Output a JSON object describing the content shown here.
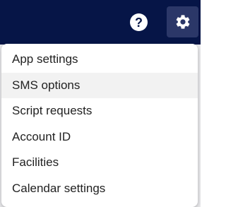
{
  "header": {
    "background": "#061547",
    "help_icon": "question-circle-icon",
    "help_glyph": "?",
    "settings_icon": "gear-icon"
  },
  "settings_menu": {
    "items": [
      {
        "label": "App settings"
      },
      {
        "label": "SMS options",
        "highlighted": true
      },
      {
        "label": "Script requests"
      },
      {
        "label": "Account ID"
      },
      {
        "label": "Facilities"
      },
      {
        "label": "Calendar settings"
      }
    ]
  }
}
